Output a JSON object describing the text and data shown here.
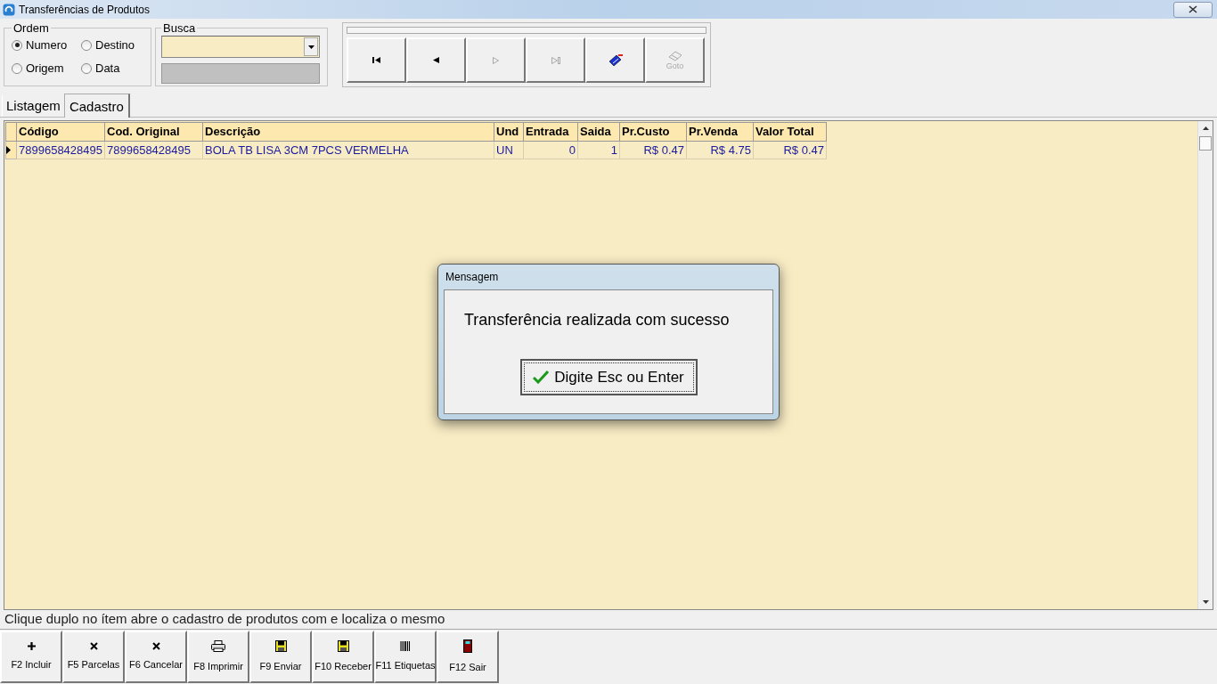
{
  "window": {
    "title": "Transferências de Produtos"
  },
  "ordem": {
    "title": "Ordem",
    "options": [
      {
        "label": "Numero",
        "selected": true
      },
      {
        "label": "Destino",
        "selected": false
      },
      {
        "label": "Origem",
        "selected": false
      },
      {
        "label": "Data",
        "selected": false
      }
    ]
  },
  "busca": {
    "title": "Busca"
  },
  "progress": {
    "level": 0
  },
  "nav_buttons": [
    {
      "kind": "first",
      "disabled": false
    },
    {
      "kind": "prev",
      "disabled": false
    },
    {
      "kind": "next",
      "disabled": true
    },
    {
      "kind": "last",
      "disabled": true
    },
    {
      "kind": "tag",
      "disabled": false
    },
    {
      "kind": "goto",
      "disabled": true,
      "label": "Goto"
    }
  ],
  "tabs": [
    {
      "label": "Listagem",
      "selected": false
    },
    {
      "label": "Cadastro",
      "selected": true
    }
  ],
  "table": {
    "columns": [
      {
        "label": "Código"
      },
      {
        "label": "Cod. Original"
      },
      {
        "label": "Descrição"
      },
      {
        "label": "Und"
      },
      {
        "label": "Entrada"
      },
      {
        "label": "Saida"
      },
      {
        "label": "Pr.Custo"
      },
      {
        "label": "Pr.Venda"
      },
      {
        "label": "Valor Total"
      }
    ],
    "rows": [
      {
        "selected": true,
        "cells": [
          "7899658428495",
          "7899658428495",
          "BOLA TB LISA 3CM 7PCS VERMELHA",
          "UN",
          "0",
          "1",
          "R$ 0.47",
          "R$ 4.75",
          "R$ 0.47"
        ]
      }
    ]
  },
  "status_text": "Clique duplo no ítem abre o cadastro de produtos com e localiza o mesmo",
  "function_buttons": [
    {
      "kind": "plus",
      "label": "F2 Incluir"
    },
    {
      "kind": "x",
      "label": "F5 Parcelas"
    },
    {
      "kind": "x",
      "label": "F6 Cancelar"
    },
    {
      "kind": "printer",
      "label": "F8 Imprimir"
    },
    {
      "kind": "disk",
      "label": "F9 Enviar"
    },
    {
      "kind": "disk",
      "label": "F10 Receber"
    },
    {
      "kind": "barcode",
      "label": "F11 Etiquetas"
    },
    {
      "kind": "door",
      "label": "F12 Sair"
    }
  ],
  "dialog": {
    "title": "Mensagem",
    "message": "Transferência realizada com sucesso",
    "button": "Digite Esc ou Enter"
  }
}
